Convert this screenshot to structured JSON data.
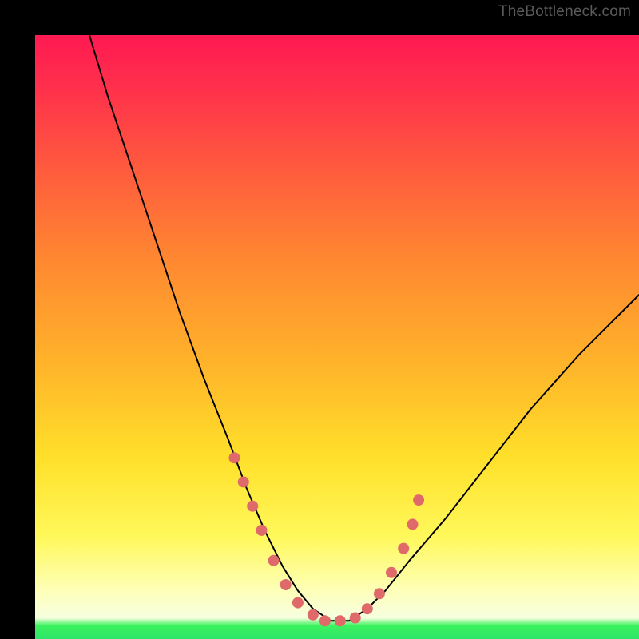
{
  "watermark": {
    "text": "TheBottleneck.com"
  },
  "chart_data": {
    "type": "line",
    "title": "",
    "xlabel": "",
    "ylabel": "",
    "xlim": [
      0,
      100
    ],
    "ylim": [
      0,
      100
    ],
    "grid": false,
    "legend": false,
    "background_gradient": {
      "orientation": "vertical",
      "stops": [
        {
          "pos": 0.0,
          "color": "#ff1a52"
        },
        {
          "pos": 0.22,
          "color": "#ff5a3e"
        },
        {
          "pos": 0.55,
          "color": "#ffb52a"
        },
        {
          "pos": 0.83,
          "color": "#fff85a"
        },
        {
          "pos": 0.965,
          "color": "#f6ffe0"
        },
        {
          "pos": 1.0,
          "color": "#2de56a"
        }
      ]
    },
    "series": [
      {
        "name": "bottleneck-curve",
        "stroke": "#000000",
        "stroke_width": 2,
        "x": [
          9,
          12,
          16,
          20,
          24,
          28,
          32,
          35,
          38,
          41,
          43.5,
          46,
          49,
          52,
          55,
          58,
          62,
          68,
          75,
          82,
          90,
          100
        ],
        "y": [
          100,
          90,
          78,
          66,
          54,
          43,
          33,
          25,
          18,
          12,
          8,
          5,
          3,
          3,
          5,
          8,
          13,
          20,
          29,
          38,
          47,
          57
        ]
      }
    ],
    "markers": {
      "name": "dots",
      "color": "#e06a6a",
      "radius": 7,
      "points": [
        {
          "x": 33,
          "y": 30
        },
        {
          "x": 34.5,
          "y": 26
        },
        {
          "x": 36,
          "y": 22
        },
        {
          "x": 37.5,
          "y": 18
        },
        {
          "x": 39.5,
          "y": 13
        },
        {
          "x": 41.5,
          "y": 9
        },
        {
          "x": 43.5,
          "y": 6
        },
        {
          "x": 46,
          "y": 4
        },
        {
          "x": 48,
          "y": 3
        },
        {
          "x": 50.5,
          "y": 3
        },
        {
          "x": 53,
          "y": 3.5
        },
        {
          "x": 55,
          "y": 5
        },
        {
          "x": 57,
          "y": 7.5
        },
        {
          "x": 59,
          "y": 11
        },
        {
          "x": 61,
          "y": 15
        },
        {
          "x": 62.5,
          "y": 19
        },
        {
          "x": 63.5,
          "y": 23
        }
      ]
    }
  }
}
